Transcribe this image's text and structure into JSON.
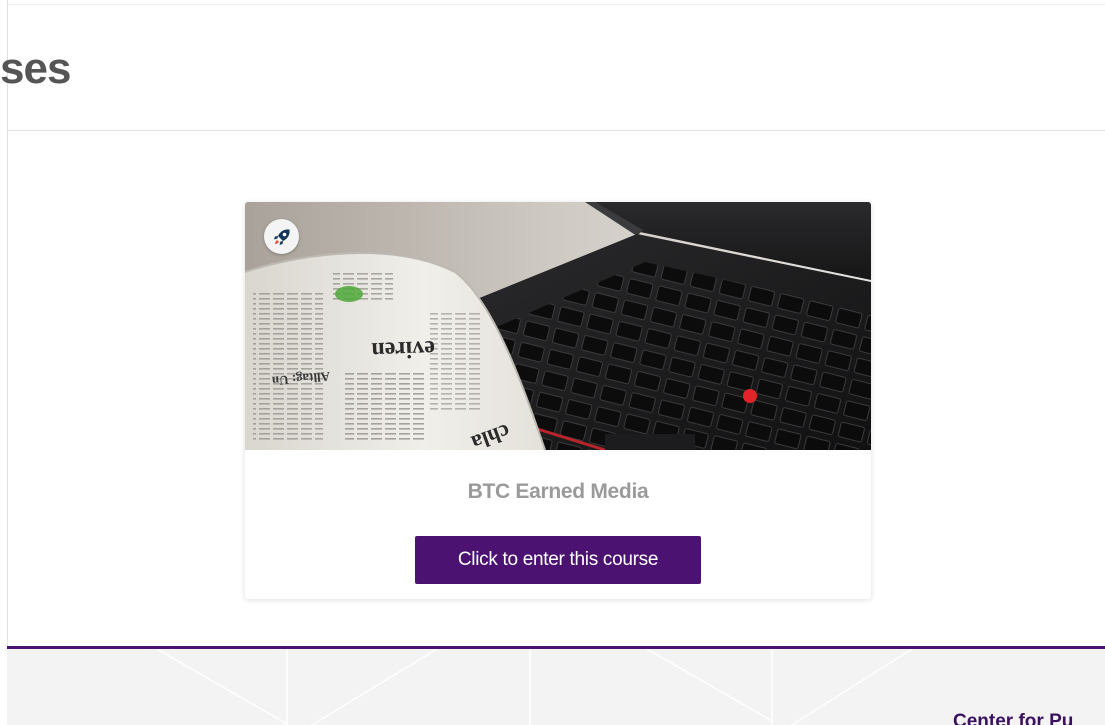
{
  "header": {
    "title": "ses"
  },
  "course_card": {
    "course_name": "BTC Earned Media",
    "enter_button_label": "Click to enter this course",
    "badge_icon": "rocket-icon",
    "image_description_icon": "newspaper-laptop-image"
  },
  "footer": {
    "org_name": "Center for Pu"
  },
  "colors": {
    "brand_purple": "#4c1272",
    "title_gray": "#555555",
    "course_name_gray": "#9a9a9a",
    "footer_bg": "#f3f3f3"
  }
}
